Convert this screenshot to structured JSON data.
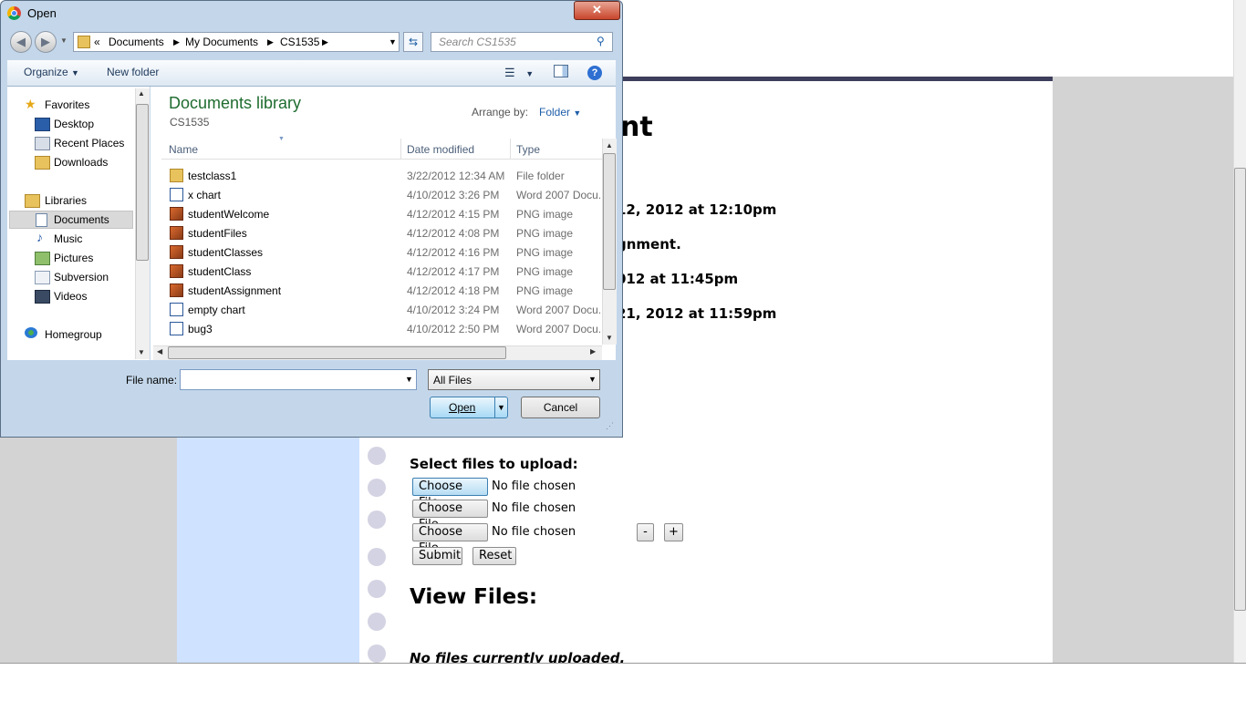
{
  "dialog": {
    "title": "Open",
    "close_label": "✕",
    "nav": {
      "back_icon": "back-arrow-icon",
      "forward_icon": "forward-arrow-icon",
      "breadcrumbs": [
        "«",
        "Documents",
        "My Documents",
        "CS1535"
      ],
      "search_placeholder": "Search CS1535"
    },
    "toolbar": {
      "organize_label": "Organize",
      "new_folder_label": "New folder",
      "help_label": "?"
    },
    "nav_pane": {
      "favorites_label": "Favorites",
      "favorites": [
        "Desktop",
        "Recent Places",
        "Downloads"
      ],
      "libraries_label": "Libraries",
      "libraries": [
        "Documents",
        "Music",
        "Pictures",
        "Subversion",
        "Videos"
      ],
      "homegroup_label": "Homegroup"
    },
    "library": {
      "title": "Documents library",
      "subtitle": "CS1535",
      "arrange_label": "Arrange by:",
      "arrange_value": "Folder"
    },
    "columns": {
      "name": "Name",
      "date": "Date modified",
      "type": "Type"
    },
    "files": [
      {
        "name": "testclass1",
        "date": "3/22/2012 12:34 AM",
        "type": "File folder",
        "icon": "folder-icon"
      },
      {
        "name": "x chart",
        "date": "4/10/2012 3:26 PM",
        "type": "Word 2007 Docu...",
        "icon": "word-doc-icon"
      },
      {
        "name": "studentWelcome",
        "date": "4/12/2012 4:15 PM",
        "type": "PNG image",
        "icon": "png-image-icon"
      },
      {
        "name": "studentFiles",
        "date": "4/12/2012 4:08 PM",
        "type": "PNG image",
        "icon": "png-image-icon"
      },
      {
        "name": "studentClasses",
        "date": "4/12/2012 4:16 PM",
        "type": "PNG image",
        "icon": "png-image-icon"
      },
      {
        "name": "studentClass",
        "date": "4/12/2012 4:17 PM",
        "type": "PNG image",
        "icon": "png-image-icon"
      },
      {
        "name": "studentAssignment",
        "date": "4/12/2012 4:18 PM",
        "type": "PNG image",
        "icon": "png-image-icon"
      },
      {
        "name": "empty chart",
        "date": "4/10/2012 3:24 PM",
        "type": "Word 2007 Docu...",
        "icon": "word-doc-icon"
      },
      {
        "name": "bug3",
        "date": "4/10/2012 2:50 PM",
        "type": "Word 2007 Docu...",
        "icon": "word-doc-icon"
      }
    ],
    "file_name_label": "File name:",
    "file_name_value": "",
    "file_type_value": "All Files",
    "open_label": "Open",
    "cancel_label": "Cancel"
  },
  "page": {
    "heading_partial": "nt",
    "line1": "12, 2012 at 12:10pm",
    "line2": "gnment.",
    "line3": "012 at 11:45pm",
    "line4": "21, 2012 at 11:59pm",
    "upload_heading": "Select files to upload:",
    "choose_file_label": "Choose File",
    "no_file_text": "No file chosen",
    "minus_label": "-",
    "plus_label": "+",
    "submit_label": "Submit",
    "reset_label": "Reset",
    "view_files_heading": "View Files:",
    "no_files_text": "No files currently uploaded."
  },
  "colors": {
    "sidebar": "#cfe2ff",
    "accent_bar": "#3d3d5c",
    "library_title": "#1e6c2f"
  }
}
